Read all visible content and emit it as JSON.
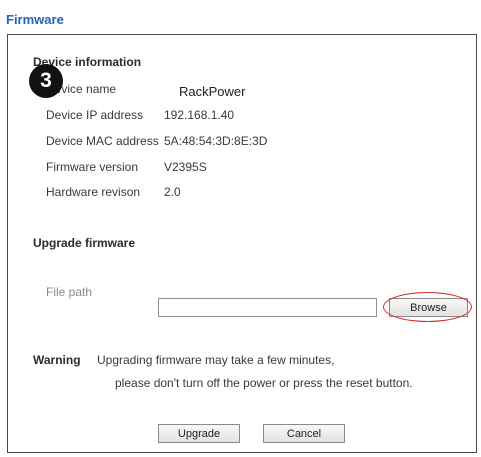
{
  "page": {
    "title": "Firmware"
  },
  "device_info": {
    "heading": "Device information",
    "step_badge": "3",
    "rows": [
      {
        "label": "Device name",
        "value": "RackPower"
      },
      {
        "label": "Device IP address",
        "value": "192.168.1.40"
      },
      {
        "label": "Device MAC address",
        "value": "5A:48:54:3D:8E:3D"
      },
      {
        "label": "Firmware version",
        "value": "V2395S"
      },
      {
        "label": "Hardware revison",
        "value": "2.0"
      }
    ]
  },
  "upgrade": {
    "heading": "Upgrade firmware",
    "file_path_label": "File path",
    "file_path_value": "",
    "browse_label": "Browse"
  },
  "warning": {
    "label": "Warning",
    "line1": "Upgrading firmware may take a few minutes,",
    "line2": "please don't turn off the power or press the reset button."
  },
  "actions": {
    "upgrade_label": "Upgrade",
    "cancel_label": "Cancel"
  },
  "colors": {
    "title": "#2a64b0",
    "highlight_ring": "#d22a2a",
    "badge_bg": "#111111"
  }
}
